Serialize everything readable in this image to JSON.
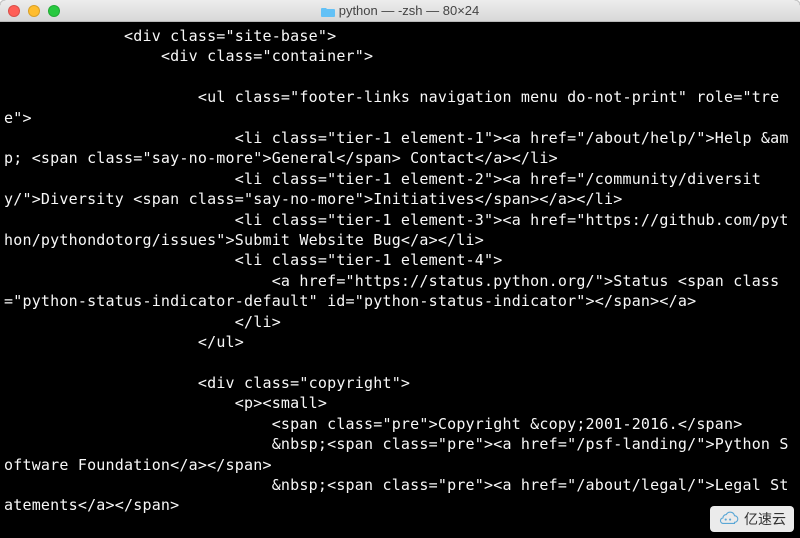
{
  "window": {
    "title": "python — -zsh — 80×24",
    "traffic_lights": {
      "close": "red",
      "minimize": "yellow",
      "zoom": "green"
    }
  },
  "terminal": {
    "content": "             <div class=\"site-base\">\n                 <div class=\"container\">\n\n                     <ul class=\"footer-links navigation menu do-not-print\" role=\"tree\">\n                         <li class=\"tier-1 element-1\"><a href=\"/about/help/\">Help &amp; <span class=\"say-no-more\">General</span> Contact</a></li>\n                         <li class=\"tier-1 element-2\"><a href=\"/community/diversity/\">Diversity <span class=\"say-no-more\">Initiatives</span></a></li>\n                         <li class=\"tier-1 element-3\"><a href=\"https://github.com/python/pythondotorg/issues\">Submit Website Bug</a></li>\n                         <li class=\"tier-1 element-4\">\n                             <a href=\"https://status.python.org/\">Status <span class=\"python-status-indicator-default\" id=\"python-status-indicator\"></span></a>\n                         </li>\n                     </ul>\n\n                     <div class=\"copyright\">\n                         <p><small>\n                             <span class=\"pre\">Copyright &copy;2001-2016.</span>\n                             &nbsp;<span class=\"pre\"><a href=\"/psf-landing/\">Python Software Foundation</a></span>\n                             &nbsp;<span class=\"pre\"><a href=\"/about/legal/\">Legal Statements</a></span>"
  },
  "watermark": {
    "text": "亿速云"
  }
}
